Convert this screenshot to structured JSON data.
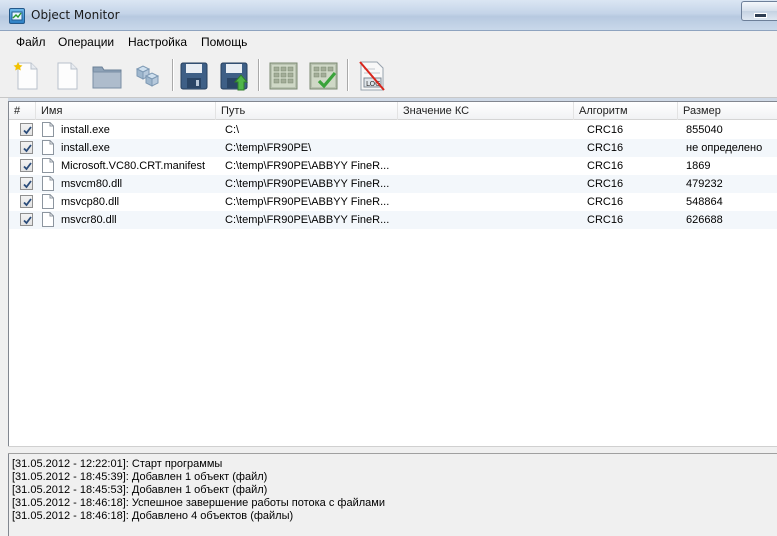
{
  "window": {
    "title": "Object Monitor"
  },
  "menu": [
    "Файл",
    "Операции",
    "Настройка",
    "Помощь"
  ],
  "toolbar": [
    {
      "name": "new-icon"
    },
    {
      "name": "open-file-icon"
    },
    {
      "name": "open-folder-icon"
    },
    {
      "name": "objects-icon"
    },
    {
      "name": "save-icon"
    },
    {
      "name": "save-as-icon"
    },
    {
      "name": "calculate-icon"
    },
    {
      "name": "verify-icon"
    },
    {
      "name": "log-icon"
    }
  ],
  "table": {
    "columns": [
      "#",
      "Имя",
      "Путь",
      "Значение КС",
      "Алгоритм",
      "Размер"
    ],
    "rows": [
      {
        "checked": true,
        "name": "install.exe",
        "path": "C:\\",
        "value": "",
        "algorithm": "CRC16",
        "size": "855040"
      },
      {
        "checked": true,
        "name": "install.exe",
        "path": "C:\\temp\\FR90PE\\",
        "value": "",
        "algorithm": "CRC16",
        "size": "не определено"
      },
      {
        "checked": true,
        "name": "Microsoft.VC80.CRT.manifest",
        "path": "C:\\temp\\FR90PE\\ABBYY FineR...",
        "value": "",
        "algorithm": "CRC16",
        "size": "1869"
      },
      {
        "checked": true,
        "name": "msvcm80.dll",
        "path": "C:\\temp\\FR90PE\\ABBYY FineR...",
        "value": "",
        "algorithm": "CRC16",
        "size": "479232"
      },
      {
        "checked": true,
        "name": "msvcp80.dll",
        "path": "C:\\temp\\FR90PE\\ABBYY FineR...",
        "value": "",
        "algorithm": "CRC16",
        "size": "548864"
      },
      {
        "checked": true,
        "name": "msvcr80.dll",
        "path": "C:\\temp\\FR90PE\\ABBYY FineR...",
        "value": "",
        "algorithm": "CRC16",
        "size": "626688"
      }
    ]
  },
  "log": [
    "[31.05.2012 - 12:22:01]: Старт программы",
    "[31.05.2012 - 18:45:39]: Добавлен 1 объект (файл)",
    "[31.05.2012 - 18:45:53]: Добавлен 1 объект (файл)",
    "[31.05.2012 - 18:46:18]: Успешное завершение работы потока с файлами",
    "[31.05.2012 - 18:46:18]: Добавлено 4 объектов (файлы)"
  ]
}
